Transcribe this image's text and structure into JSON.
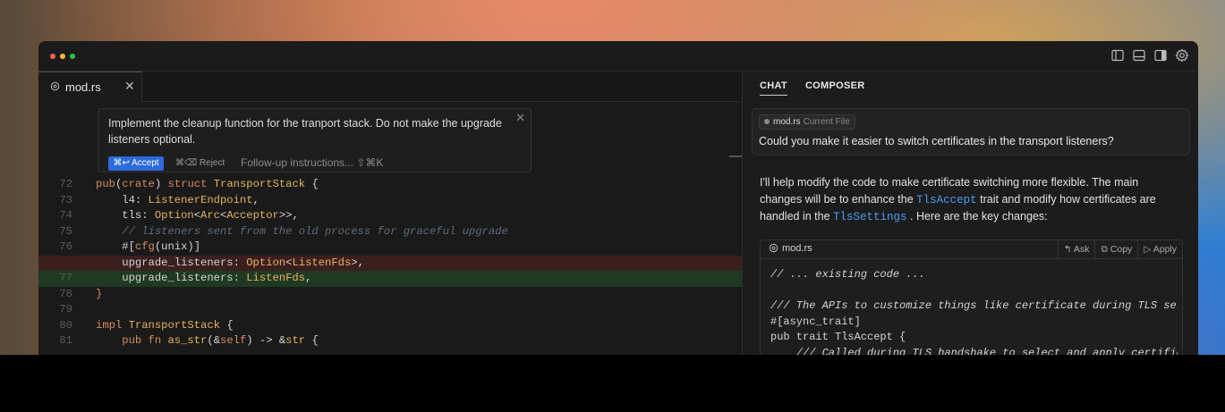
{
  "window": {
    "controls": [
      "close-dot",
      "minimize-dot",
      "zoom-dot"
    ],
    "toolbar_icons": [
      "sidebar-left-icon",
      "panel-bottom-icon",
      "sidebar-right-icon",
      "gear-icon"
    ]
  },
  "editor": {
    "tab": {
      "icon": "rust-file-icon",
      "label": "mod.rs",
      "close": "✕"
    },
    "prompt": {
      "text": "Implement the cleanup function for the tranport stack. Do not make the upgrade listeners optional.",
      "accept_label": "⌘↩ Accept",
      "reject_label": "⌘⌫ Reject",
      "followup_placeholder": "Follow-up instructions... ⇧⌘K",
      "close": "✕"
    },
    "code_lines": [
      {
        "num": "72",
        "kind": "normal"
      },
      {
        "num": "73",
        "kind": "normal"
      },
      {
        "num": "74",
        "kind": "normal"
      },
      {
        "num": "75",
        "kind": "normal"
      },
      {
        "num": "76",
        "kind": "normal"
      },
      {
        "num": "",
        "kind": "del"
      },
      {
        "num": "77",
        "kind": "add"
      },
      {
        "num": "78",
        "kind": "normal"
      },
      {
        "num": "79",
        "kind": "normal"
      },
      {
        "num": "80",
        "kind": "normal"
      },
      {
        "num": "81",
        "kind": "normal"
      }
    ]
  },
  "chat": {
    "tabs": [
      "CHAT",
      "COMPOSER"
    ],
    "active_tab": "CHAT",
    "user_message": {
      "chip_file": "mod.rs",
      "chip_sub": "Current File",
      "text": "Could you make it easier to switch certificates in the transport listeners?"
    },
    "assistant": {
      "p1": "I'll help modify the code to make certificate switching more flexible. The main changes will be to enhance the",
      "code1": "TlsAccept",
      "p2": "trait and modify how certificates are handled in the",
      "code2": "TlsSettings",
      "p3": ". Here are the key changes:"
    },
    "codeblock": {
      "file": "mod.rs",
      "actions": [
        "↰ Ask",
        "⧉ Copy",
        "▷ Apply"
      ],
      "lines": [
        "// ... existing code ...",
        "",
        "/// The APIs to customize things like certificate during TLS ser",
        "#[async_trait]",
        "pub trait TlsAccept {",
        "    /// Called during TLS handshake to select and apply certific"
      ]
    }
  },
  "colors": {
    "accent_blue": "#2b6bdb",
    "deleted_line": "#3b1f1f",
    "added_line": "#1f3a22",
    "inline_code": "#4c9cf0"
  }
}
